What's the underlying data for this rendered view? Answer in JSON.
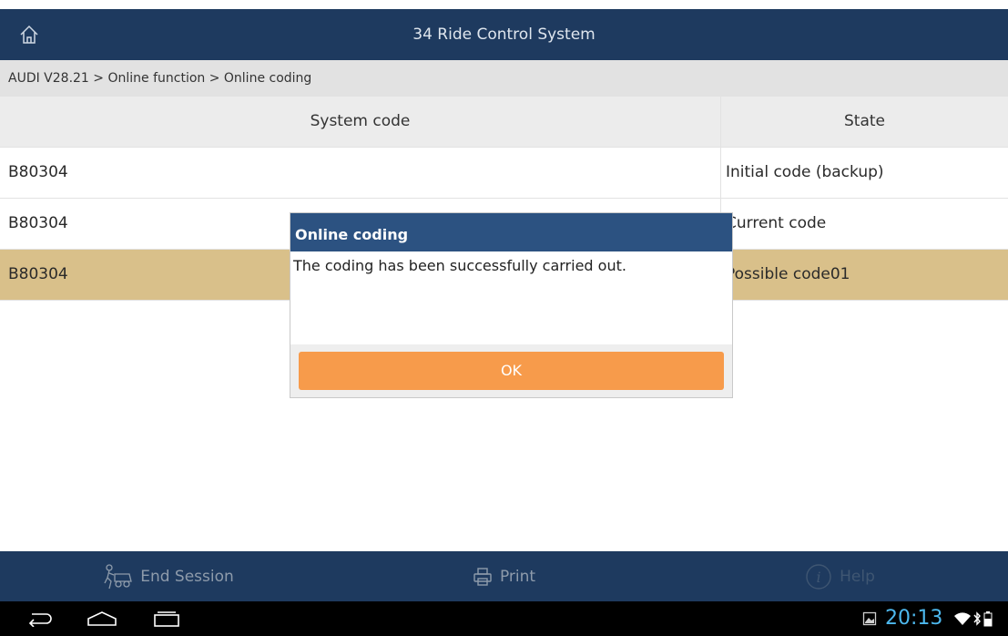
{
  "header": {
    "title": "34 Ride Control System",
    "home_icon": "home-icon"
  },
  "breadcrumb": "AUDI V28.21 > Online function > Online coding",
  "table": {
    "columns": [
      "System code",
      "State"
    ],
    "rows": [
      {
        "code": "B80304",
        "state": "Initial code (backup)",
        "highlighted": false
      },
      {
        "code": "B80304",
        "state": "Current code",
        "highlighted": false
      },
      {
        "code": "B80304",
        "state": "Possible code01",
        "highlighted": true
      }
    ]
  },
  "dialog": {
    "title": "Online coding",
    "message": "The coding has been successfully carried out.",
    "ok_label": "OK"
  },
  "bottom_bar": {
    "end_session": "End Session",
    "print": "Print",
    "help": "Help"
  },
  "status": {
    "time": "20:13"
  },
  "colors": {
    "title_bar": "#1e3a5f",
    "dialog_title": "#2c5281",
    "ok_button": "#f79b4b",
    "highlight_row": "#d9c08a",
    "clock": "#4db8ee"
  }
}
